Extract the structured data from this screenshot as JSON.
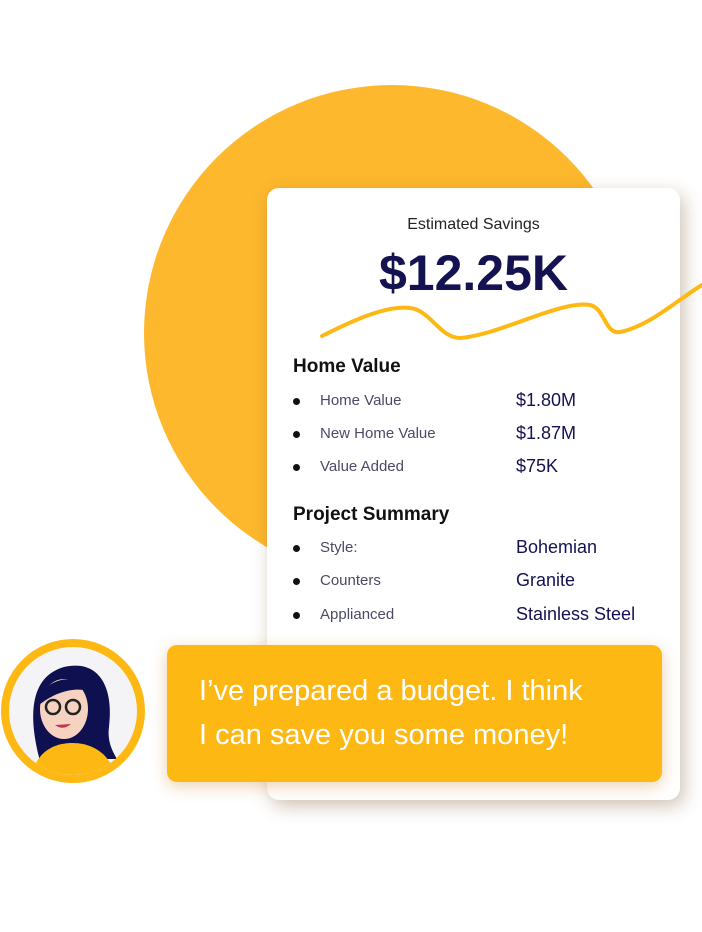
{
  "savings": {
    "label": "Estimated Savings",
    "value": "$12.25K"
  },
  "home_value": {
    "title": "Home Value",
    "rows": [
      {
        "label": "Home Value",
        "value": "$1.80M"
      },
      {
        "label": "New Home Value",
        "value": "$1.87M"
      },
      {
        "label": "Value Added",
        "value": "$75K"
      }
    ]
  },
  "project_summary": {
    "title": "Project Summary",
    "rows": [
      {
        "label": "Style:",
        "value": "Bohemian"
      },
      {
        "label": "Counters",
        "value": "Granite"
      },
      {
        "label": "Applianced",
        "value": "Stainless Steel"
      }
    ]
  },
  "chat": {
    "line1": "I’ve prepared a budget. I think",
    "line2": "I can save you some money!"
  },
  "colors": {
    "accent": "#FDB813",
    "navy": "#141250"
  }
}
